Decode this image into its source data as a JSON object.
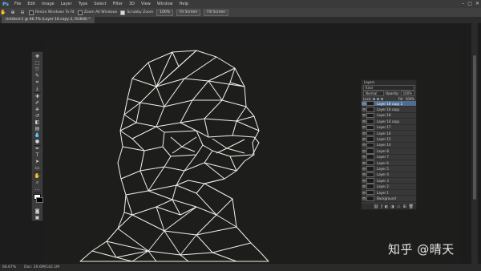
{
  "menubar": {
    "logo": "Ps",
    "items": [
      "File",
      "Edit",
      "Image",
      "Layer",
      "Type",
      "Select",
      "Filter",
      "3D",
      "View",
      "Window",
      "Help"
    ],
    "window_controls": [
      "–",
      "▢",
      "✕"
    ]
  },
  "options_bar": {
    "icons": [
      "hand-icon",
      "zoom-in-icon",
      "zoom-out-icon"
    ],
    "resize_windows_label": "Resize Windows To Fit",
    "zoom_all_label": "Zoom All Windows",
    "scrubby_label": "Scrubby Zoom",
    "btn_100": "100%",
    "btn_fit": "Fit Screen",
    "btn_fill": "Fill Screen"
  },
  "document_tab": {
    "title": "Untitled-1 @ 66.7% (Layer 18 copy 2, RGB/8) *"
  },
  "toolbox": {
    "tools": [
      "move",
      "marquee",
      "lasso",
      "quick-select",
      "crop",
      "eyedropper",
      "healing",
      "brush",
      "clone",
      "history",
      "eraser",
      "gradient",
      "blur",
      "dodge",
      "pen",
      "type",
      "path-select",
      "shape",
      "hand",
      "zoom"
    ]
  },
  "layers_panel": {
    "title": "Layers",
    "filter_label": "Kind",
    "blend_mode": "Normal",
    "opacity_label": "Opacity:",
    "opacity_value": "100%",
    "lock_label": "Lock:",
    "fill_label": "Fill:",
    "fill_value": "100%",
    "layers": [
      {
        "name": "Layer 18 copy 2",
        "active": true
      },
      {
        "name": "Layer 18 copy",
        "active": false
      },
      {
        "name": "Layer 18",
        "active": false
      },
      {
        "name": "Layer 16 copy",
        "active": false
      },
      {
        "name": "Layer 17",
        "active": false
      },
      {
        "name": "Layer 16",
        "active": false
      },
      {
        "name": "Layer 15",
        "active": false
      },
      {
        "name": "Layer 14",
        "active": false
      },
      {
        "name": "Layer 8",
        "active": false
      },
      {
        "name": "Layer 7",
        "active": false
      },
      {
        "name": "Layer 6",
        "active": false
      },
      {
        "name": "Layer 5",
        "active": false
      },
      {
        "name": "Layer 4",
        "active": false
      },
      {
        "name": "Layer 3",
        "active": false
      },
      {
        "name": "Layer 2",
        "active": false
      },
      {
        "name": "Layer 1",
        "active": false
      },
      {
        "name": "Background",
        "active": false
      }
    ],
    "footer_icons": [
      "link-icon",
      "fx-icon",
      "mask-icon",
      "adjustment-icon",
      "folder-icon",
      "new-layer-icon",
      "trash-icon"
    ]
  },
  "statusbar": {
    "zoom": "66.67%",
    "doc_info": "Doc: 20.6M/142.1M"
  },
  "watermark": "知乎 @晴天",
  "colors": {
    "menubar": "#3a3a3a",
    "canvas": "#1d1d1b",
    "active_layer": "#4e6d8f",
    "wire": "#f4f1ea"
  }
}
